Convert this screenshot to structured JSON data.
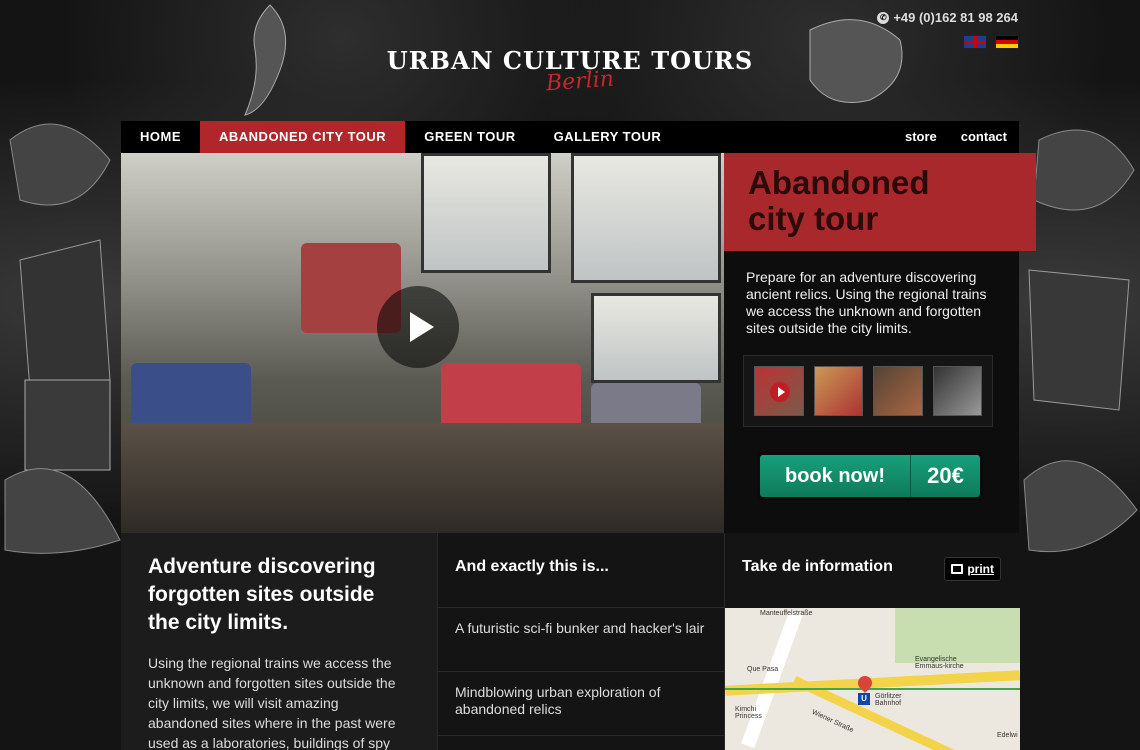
{
  "header": {
    "phone": "+49 (0)162 81 98 264",
    "logo_main": "URBAN CULTURE TOURS",
    "logo_sub": "Berlin",
    "languages": [
      "English",
      "Deutsch"
    ]
  },
  "nav": {
    "items": [
      "HOME",
      "ABANDONED CITY TOUR",
      "GREEN TOUR",
      "GALLERY TOUR"
    ],
    "active_index": 1,
    "right": [
      "store",
      "contact"
    ]
  },
  "hero": {
    "title_line1": "Abandoned",
    "title_line2": "city tour",
    "description": "Prepare for an adventure discovering ancient relics. Using the regional trains we access the unknown and forgotten sites outside the city limits.",
    "book_label": "book now!",
    "price": "20€"
  },
  "column1": {
    "heading": "Adventure discovering forgotten sites outside the city limits.",
    "body": "Using the regional trains we access the unknown and forgotten sites outside the city limits, we will visit amazing abandoned sites where in the past were used as a laboratories, buildings of spy"
  },
  "column2": {
    "heading": "And exactly this is...",
    "items": [
      "A futuristic sci-fi bunker and hacker's lair",
      "Mindblowing urban exploration of abandoned relics"
    ]
  },
  "column3": {
    "heading": "Take de information",
    "print_label": "print",
    "map_labels": [
      "Manteuffelstraße",
      "Que Pasa",
      "Evangelische Emmaus-kirche",
      "Görlitzer Bahnhof",
      "Wiener Straße",
      "Kimchi Princess",
      "Edelwi"
    ]
  },
  "colors": {
    "accent_red": "#b0262b",
    "book_green": "#17a07a"
  }
}
